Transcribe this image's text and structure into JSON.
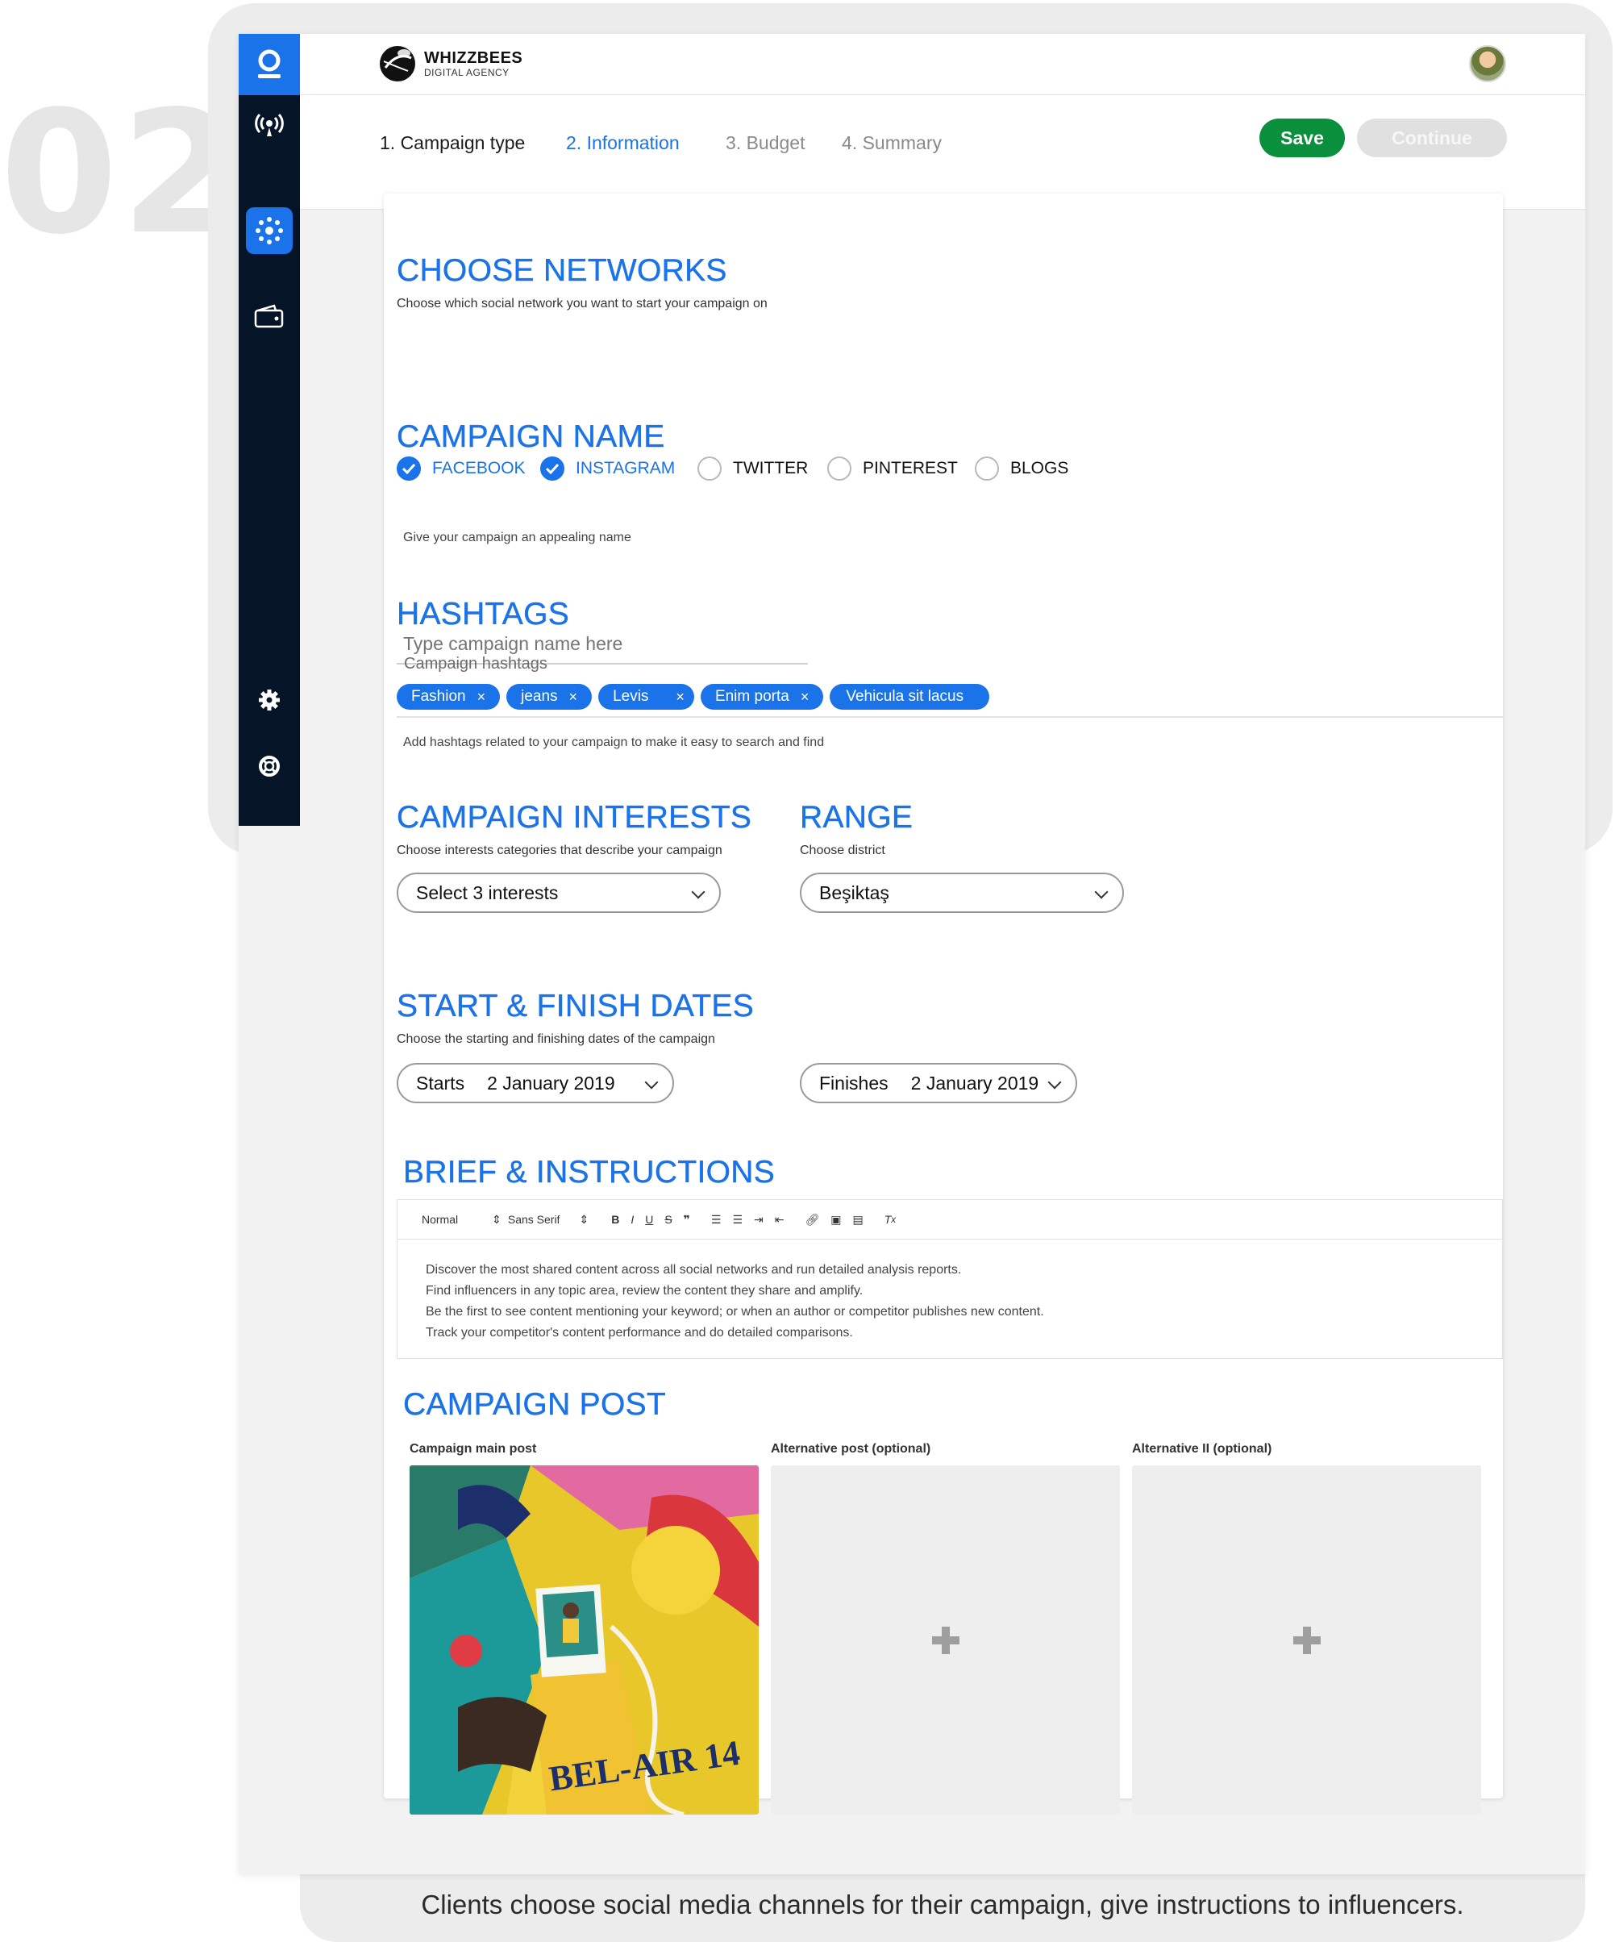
{
  "step_number": "02",
  "caption": "Clients choose social media channels for their campaign, give instructions to influencers.",
  "brand": {
    "name": "WHIZZBEES",
    "subtitle": "DIGITAL AGENCY"
  },
  "sidebar": {
    "items": [
      {
        "icon": "broadcast-icon"
      },
      {
        "icon": "network-hub-icon",
        "active": true
      },
      {
        "icon": "wallet-icon"
      },
      {
        "icon": "gear-icon"
      },
      {
        "icon": "lifebuoy-icon"
      }
    ]
  },
  "steps": [
    {
      "label": "1. Campaign type",
      "state": "completed"
    },
    {
      "label": "2. Information",
      "state": "active"
    },
    {
      "label": "3. Budget",
      "state": "pending"
    },
    {
      "label": "4. Summary",
      "state": "pending"
    }
  ],
  "actions": {
    "save": "Save",
    "continue": "Continue"
  },
  "networks": {
    "title": "CHOOSE NETWORKS",
    "subtitle": "Choose which social network you want to start your campaign on",
    "options": [
      {
        "label": "FACEBOOK",
        "checked": true
      },
      {
        "label": "INSTAGRAM",
        "checked": true
      },
      {
        "label": "TWITTER",
        "checked": false
      },
      {
        "label": "PINTEREST",
        "checked": false
      },
      {
        "label": "BLOGS",
        "checked": false
      }
    ]
  },
  "campaign_name": {
    "title": "CAMPAIGN NAME",
    "placeholder": "Type campaign name here",
    "helper": "Give your campaign an appealing name"
  },
  "hashtags": {
    "title": "HASHTAGS",
    "label": "Campaign hashtags",
    "tags": [
      "Fashion",
      "jeans",
      "Levis",
      "Enim porta",
      "Vehicula sit lacus"
    ],
    "helper": "Add hashtags related to your campaign to make it easy to search and find"
  },
  "interests": {
    "title": "CAMPAIGN INTERESTS",
    "subtitle": "Choose interests categories that describe your campaign",
    "value": "Select 3 interests"
  },
  "range": {
    "title": "RANGE",
    "subtitle": "Choose district",
    "value": "Beşiktaş"
  },
  "dates": {
    "title": "START & FINISH DATES",
    "subtitle": "Choose the starting and finishing dates of the campaign",
    "start_label": "Starts",
    "start_value": "2 January 2019",
    "finish_label": "Finishes",
    "finish_value": "2 January 2019"
  },
  "brief": {
    "title": "BRIEF & INSTRUCTIONS",
    "toolbar": {
      "format": "Normal",
      "font": "Sans Serif"
    },
    "lines": [
      "Discover the most shared content across all social networks and run detailed analysis reports.",
      "Find influencers in any topic area, review the content they share and amplify.",
      "Be the first to see content mentioning your keyword; or when an author or competitor publishes new content.",
      "Track your competitor's content performance and do detailed comparisons."
    ]
  },
  "post": {
    "title": "CAMPAIGN POST",
    "main_label": "Campaign main post",
    "alt1_label": "Alternative post (optional)",
    "alt2_label": "Alternative II (optional)",
    "photo_jersey_text": "BEL-AIR 14"
  },
  "colors": {
    "accent": "#1a73e8",
    "save": "#0a8f3d",
    "sidebar": "#061427"
  }
}
